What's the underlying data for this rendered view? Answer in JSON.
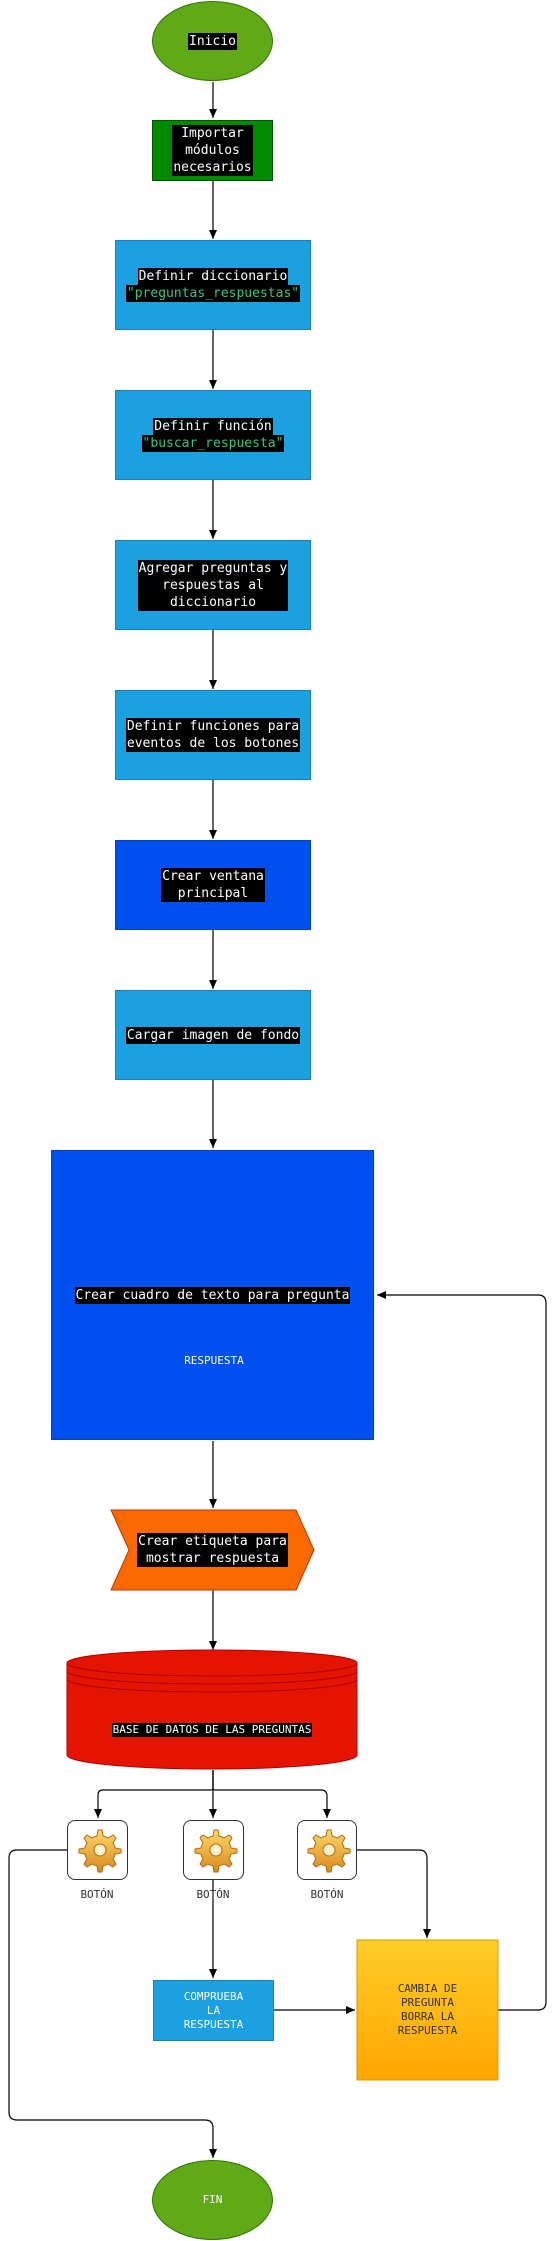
{
  "nodes": {
    "inicio": "Inicio",
    "importar": "Importar\nmódulos\nnecesarios",
    "diccionario_label": "Definir diccionario",
    "diccionario_name": "\"preguntas_respuestas\"",
    "funcion_label": "Definir función",
    "funcion_name": "\"buscar_respuesta\"",
    "agregar": "Agregar preguntas y\nrespuestas al\ndiccionario",
    "eventos": "Definir funciones para\neventos de los botones",
    "ventana": "Crear ventana\nprincipal",
    "imagen": "Cargar imagen de fondo",
    "cuadro": "Crear cuadro de texto para pregunta",
    "respuesta": "RESPUESTA",
    "etiqueta": "Crear etiqueta para\nmostrar respuesta",
    "base_datos": "BASE DE DATOS DE LAS PREGUNTAS",
    "boton_1": "BOTÓN",
    "boton_2": "BOTÓN",
    "boton_3": "BOTÓN",
    "comprueba": "COMPRUEBA\nLA\nRESPUESTA",
    "cambia": "CAMBIA DE\nPREGUNTA\nBORRA LA\nRESPUESTA",
    "fin": "FIN"
  },
  "colors": {
    "start_end_fill": "#60a917",
    "process_fill": "#1ba1e2",
    "window_fill": "#0050ef",
    "import_fill": "#008a00",
    "respuesta_fill": "#d80073",
    "label_fill": "#fa6800",
    "database_fill": "#e51400",
    "cambia_fill": "#ffc61a",
    "edge": "#000000"
  },
  "icons": [
    "gear-icon",
    "gear-icon",
    "gear-icon"
  ]
}
